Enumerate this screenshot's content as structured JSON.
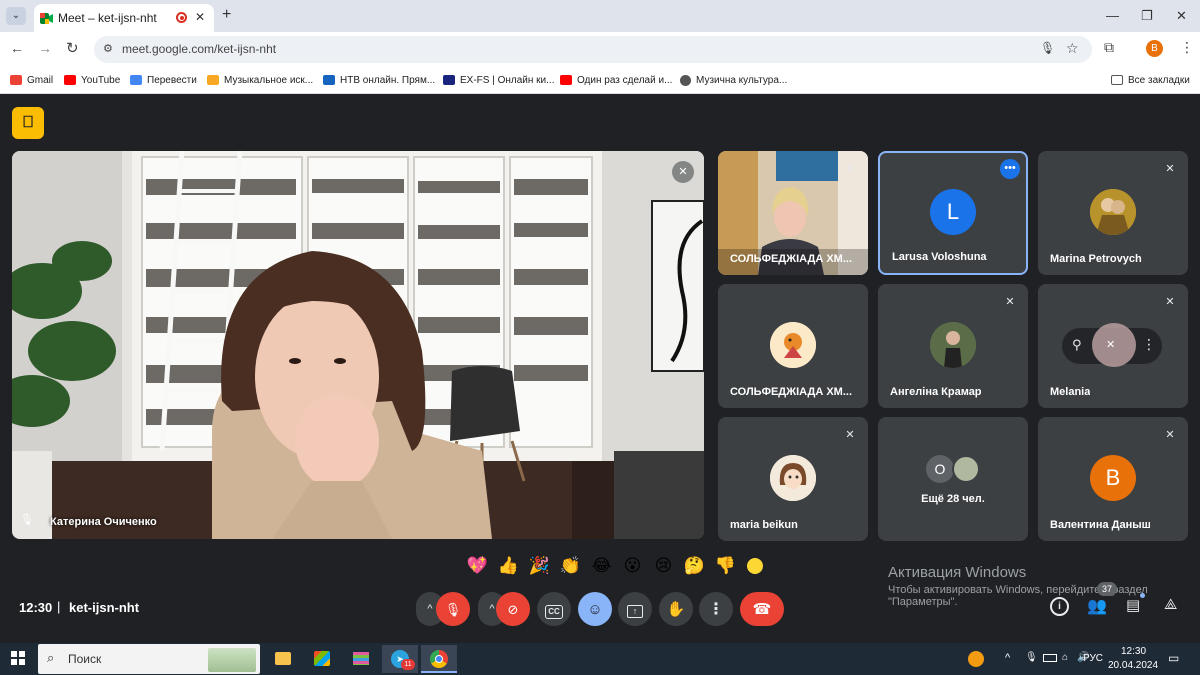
{
  "browser": {
    "tab_title": "Meet – ket-ijsn-nht",
    "new_tab": "+",
    "url": "meet.google.com/ket-ijsn-nht",
    "profile_initial": "B",
    "all_bookmarks": "Все закладки",
    "bookmarks": [
      {
        "label": "Gmail",
        "color": "#ea4335"
      },
      {
        "label": "YouTube",
        "color": "#ff0000"
      },
      {
        "label": "Перевести",
        "color": "#4285f4"
      },
      {
        "label": "Музыкальное иск...",
        "color": "#f9a825"
      },
      {
        "label": "НТВ онлайн. Прям...",
        "color": "#1565c0"
      },
      {
        "label": "EX-FS | Онлайн ки...",
        "color": "#1a237e"
      },
      {
        "label": "Один раз сделай и...",
        "color": "#ff0000"
      },
      {
        "label": "Музична культура...",
        "color": "#555555"
      }
    ]
  },
  "meet": {
    "main_participant": "Катерина Очиченко",
    "tiles": [
      {
        "name": "СОЛЬФЕДЖІАДА ХМ...",
        "type": "video"
      },
      {
        "name": "Larusa Voloshuna",
        "type": "initial",
        "initial": "L",
        "color": "#1a73e8"
      },
      {
        "name": "Marina Petrovych",
        "type": "image"
      },
      {
        "name": "СОЛЬФЕДЖІАДА ХМ...",
        "type": "image"
      },
      {
        "name": "Ангеліна Крамар",
        "type": "image"
      },
      {
        "name": "Melania",
        "type": "image"
      },
      {
        "name": "maria beikun",
        "type": "image"
      },
      {
        "name": "Ещё 28 чел.",
        "type": "more",
        "initial": "O"
      },
      {
        "name": "Валентина Даныш",
        "type": "initial",
        "initial": "B",
        "color": "#e8710a"
      }
    ],
    "reactions": [
      "💖",
      "👍",
      "🎉",
      "👏",
      "😂",
      "😮",
      "😢",
      "🤔",
      "👎"
    ],
    "time": "12:30",
    "separator": "|",
    "meeting_code": "ket-ijsn-nht",
    "participants_badge": "37",
    "activation_title": "Активация Windows",
    "activation_text1": "Чтобы активировать Windows, перейдите в раздел",
    "activation_text2": "\"Параметры\"."
  },
  "taskbar": {
    "search_label": "Поиск",
    "lang": "РУС",
    "time": "12:30",
    "date": "20.04.2024",
    "telegram_badge": "11"
  }
}
